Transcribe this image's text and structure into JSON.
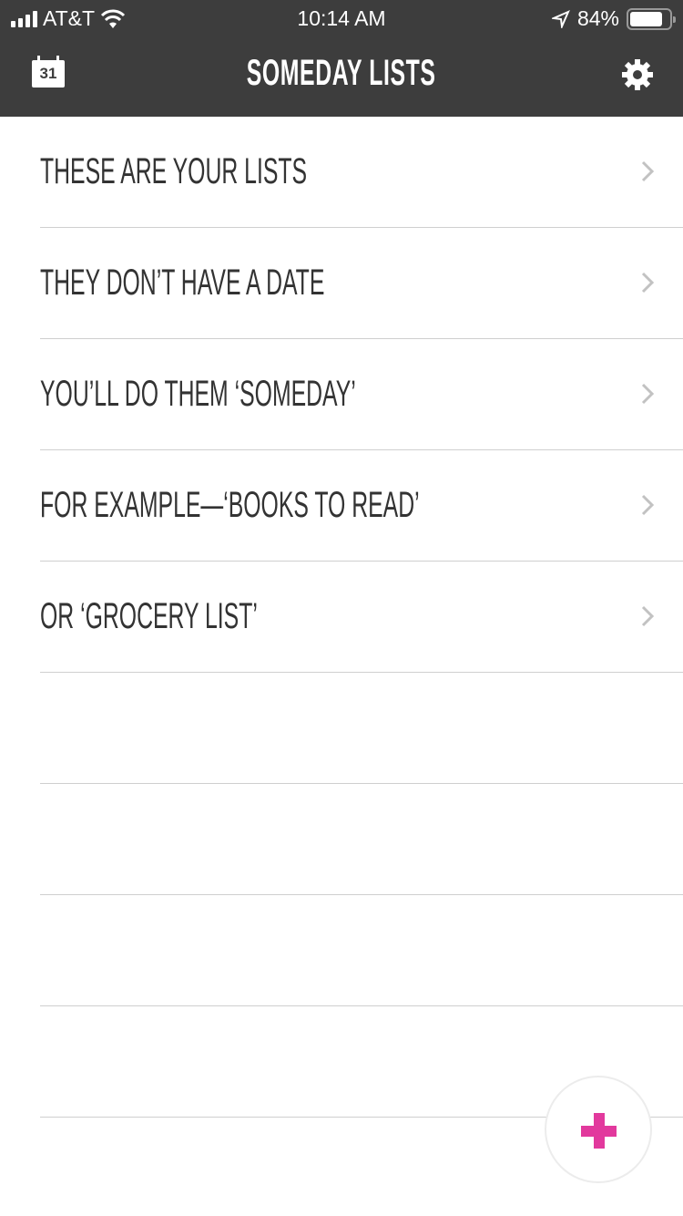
{
  "status": {
    "carrier": "AT&T",
    "time": "10:14 AM",
    "battery": "84%",
    "battery_level": 0.84
  },
  "header": {
    "title": "SOMEDAY LISTS",
    "calendar_day": "31"
  },
  "lists": [
    {
      "label": "THESE ARE YOUR LISTS"
    },
    {
      "label": "THEY DON’T HAVE A DATE"
    },
    {
      "label": "YOU’LL DO THEM ‘SOMEDAY’"
    },
    {
      "label": "FOR EXAMPLE—‘BOOKS TO READ’"
    },
    {
      "label": "OR ‘GROCERY LIST’"
    },
    {
      "label": ""
    },
    {
      "label": ""
    },
    {
      "label": ""
    },
    {
      "label": ""
    }
  ],
  "colors": {
    "header": "#3d3d3d",
    "accent": "#e2399d"
  }
}
